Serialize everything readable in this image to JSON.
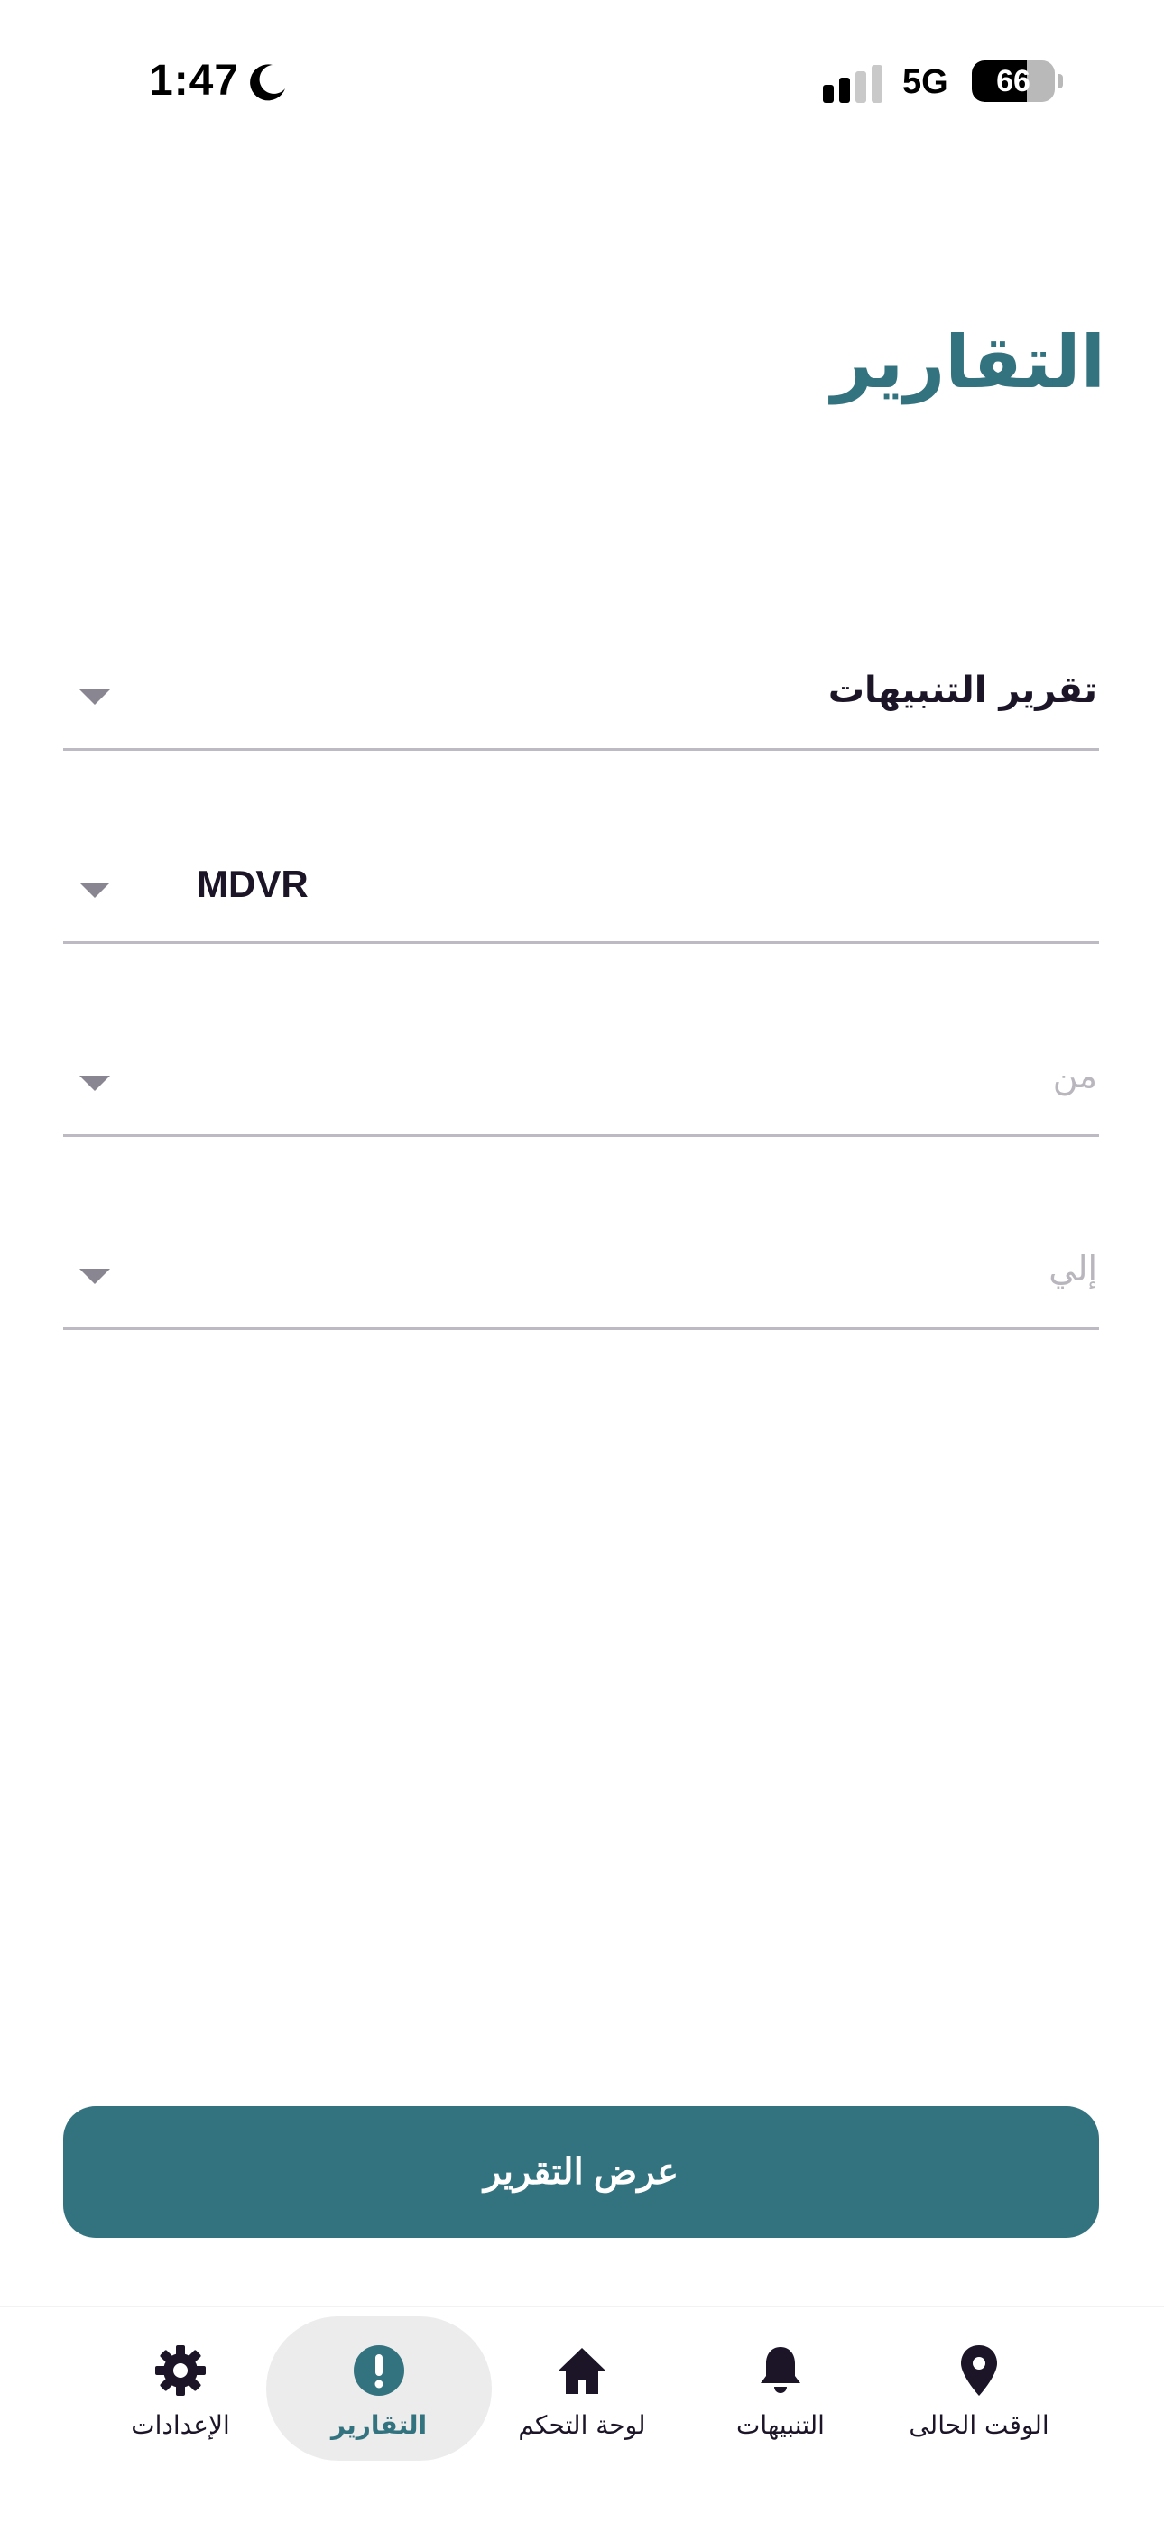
{
  "status_bar": {
    "time": "1:47",
    "network": "5G",
    "battery": "66",
    "battery_level": 0.66
  },
  "page": {
    "title": "التقارير"
  },
  "form": {
    "report_type": {
      "value": "تقرير التنبيهات"
    },
    "device": {
      "value": "MDVR"
    },
    "from": {
      "placeholder": "من"
    },
    "to": {
      "placeholder": "إلي"
    }
  },
  "actions": {
    "show_report": "عرض التقرير"
  },
  "bottom_nav": {
    "items": [
      {
        "label": "الإعدادات",
        "icon": "gear-icon"
      },
      {
        "label": "التقارير",
        "icon": "exclamation-circle-icon",
        "active": true
      },
      {
        "label": "لوحة التحكم",
        "icon": "home-icon"
      },
      {
        "label": "التنبيهات",
        "icon": "bell-icon"
      },
      {
        "label": "الوقت الحالى",
        "icon": "location-pin-icon"
      }
    ]
  },
  "colors": {
    "accent": "#33737f",
    "text": "#1c1528",
    "placeholder": "#b9b6bd",
    "divider": "#bdbac4",
    "nav_active_bg": "#ececec"
  }
}
